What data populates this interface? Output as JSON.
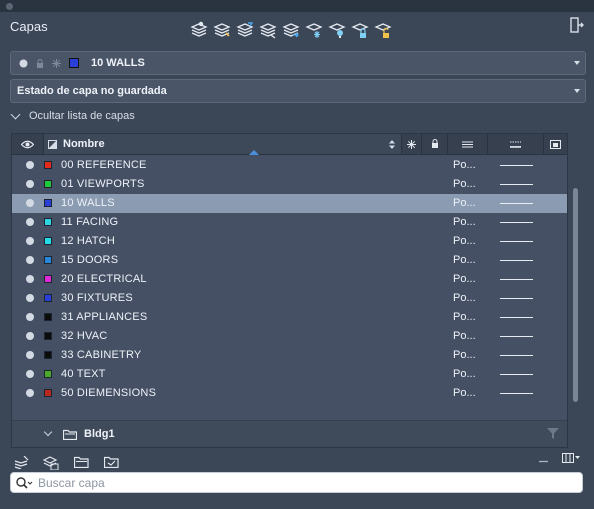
{
  "panel": {
    "title": "Capas"
  },
  "current_layer": {
    "name": "10 WALLS",
    "color": "#2a3ed8"
  },
  "layer_state": {
    "value": "Estado de capa no guardada"
  },
  "hide_list": {
    "label": "Ocultar lista de capas"
  },
  "columns": {
    "name_label": "Nombre"
  },
  "layers": [
    {
      "name": "00 REFERENCE",
      "color": "#e02a1c",
      "linetype": "Po...",
      "selected": false
    },
    {
      "name": "01 VIEWPORTS",
      "color": "#22c43a",
      "linetype": "Po...",
      "selected": false
    },
    {
      "name": "10 WALLS",
      "color": "#2a3ed8",
      "linetype": "Po...",
      "selected": true
    },
    {
      "name": "11 FACING",
      "color": "#2fd6e0",
      "linetype": "Po...",
      "selected": false
    },
    {
      "name": "12 HATCH",
      "color": "#28dbe8",
      "linetype": "Po...",
      "selected": false
    },
    {
      "name": "15 DOORS",
      "color": "#2a86d8",
      "linetype": "Po...",
      "selected": false
    },
    {
      "name": "20 ELECTRICAL",
      "color": "#e02ad8",
      "linetype": "Po...",
      "selected": false
    },
    {
      "name": "30 FIXTURES",
      "color": "#2a3ed8",
      "linetype": "Po...",
      "selected": false
    },
    {
      "name": "31 APPLIANCES",
      "color": "#0c0c0c",
      "linetype": "Po...",
      "selected": false
    },
    {
      "name": "32 HVAC",
      "color": "#0c0c0c",
      "linetype": "Po...",
      "selected": false
    },
    {
      "name": "33 CABINETRY",
      "color": "#0c0c0c",
      "linetype": "Po...",
      "selected": false
    },
    {
      "name": "40 TEXT",
      "color": "#4aa82a",
      "linetype": "Po...",
      "selected": false
    },
    {
      "name": "50 DIEMENSIONS",
      "color": "#b8281c",
      "linetype": "Po...",
      "selected": false
    }
  ],
  "group": {
    "label": "Bldg1"
  },
  "search": {
    "placeholder": "Buscar capa",
    "value": ""
  }
}
